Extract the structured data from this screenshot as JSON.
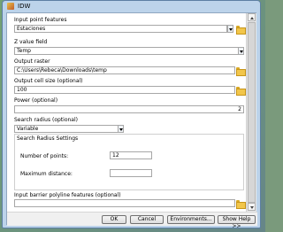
{
  "window": {
    "title": "IDW"
  },
  "form": {
    "input_point_features": {
      "label": "Input point features",
      "value": "Estaciones"
    },
    "z_value_field": {
      "label": "Z value field",
      "value": "Temp"
    },
    "output_raster": {
      "label": "Output raster",
      "value": "C:\\Users\\Rebeca\\Downloads\\temp"
    },
    "output_cell_size": {
      "label": "Output cell size (optional)",
      "value": "100"
    },
    "power": {
      "label": "Power (optional)",
      "value": "2"
    },
    "search_radius": {
      "label": "Search radius (optional)",
      "value": "Variable",
      "settings_title": "Search Radius Settings",
      "number_of_points": {
        "label": "Number of points:",
        "value": "12"
      },
      "maximum_distance": {
        "label": "Maximum distance:",
        "value": ""
      }
    },
    "input_barrier": {
      "label": "Input barrier polyline features (optional)",
      "value": ""
    }
  },
  "buttons": {
    "ok": "OK",
    "cancel": "Cancel",
    "environments": "Environments...",
    "show_help": "Show Help >>"
  }
}
